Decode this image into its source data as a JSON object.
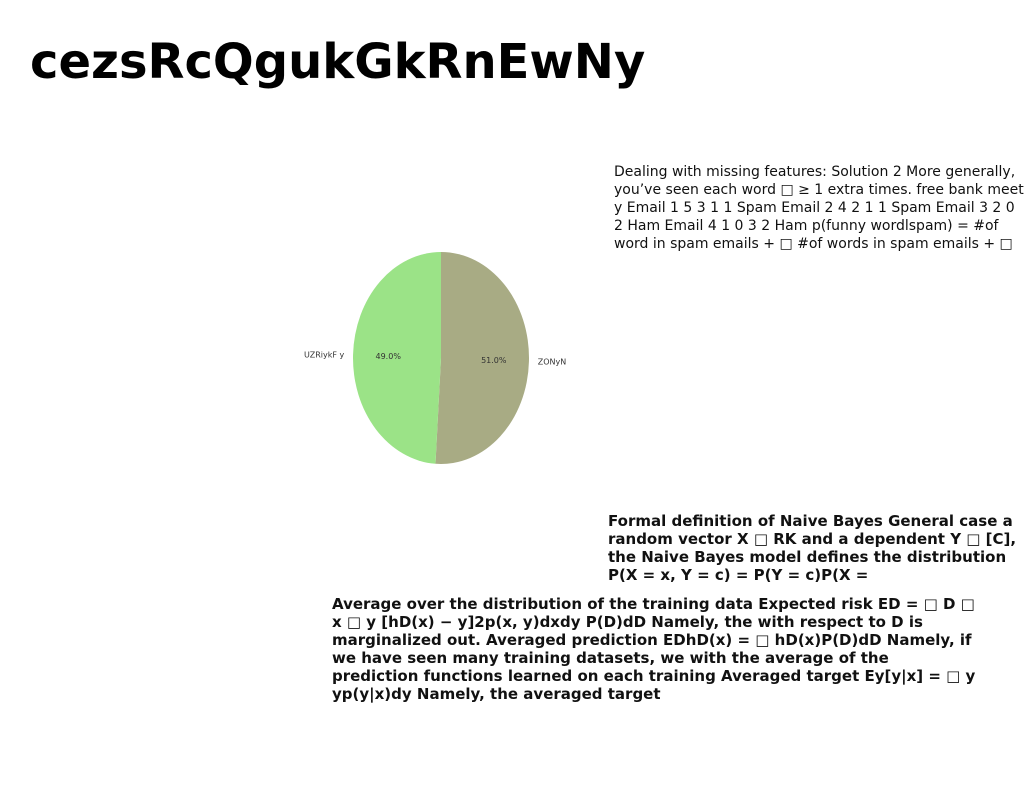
{
  "page": {
    "title": "cezsRcQgukGkRnEwNy"
  },
  "text_blocks": {
    "block_1": "Dealing with missing features: Solution 2 More generally, you’ve seen each word □ ≥ 1 extra times. free bank meet y Email 1 5 3 1 1 Spam Email 2 4 2 1 1 Spam Email 3 2 0 2 Ham Email 4 1 0 3 2 Ham p(funny wordlspam) = #of word in spam emails + □ #of words in spam emails + □ ×",
    "block_2": "Formal definition of Naive Bayes General case a random vector X □ RK and a dependent Y □ [C], the Naive Bayes model defines the distribution P(X = x, Y = c) = P(Y = c)P(X =",
    "block_3": "Average over the distribution of the training data Expected risk ED = □ D □ x □ y [hD(x) − y]2p(x, y)dxdy P(D)dD Namely, the with respect to D is marginalized out. Averaged prediction EDhD(x) = □ hD(x)P(D)dD Namely, if we have seen many training datasets, we with the average of the prediction functions learned on each training Averaged target Ey[y|x] = □ y yp(y|x)dy Namely, the averaged target"
  },
  "chart_data": {
    "type": "pie",
    "title": "",
    "slices": [
      {
        "label": "ZONyN",
        "value": 51.0,
        "pct_label": "51.0%",
        "color": "#a8ab84"
      },
      {
        "label": "UZRiykF y",
        "value": 49.0,
        "pct_label": "49.0%",
        "color": "#9be387"
      }
    ],
    "start_angle_deg": 90,
    "direction": "clockwise",
    "legend": "none"
  }
}
